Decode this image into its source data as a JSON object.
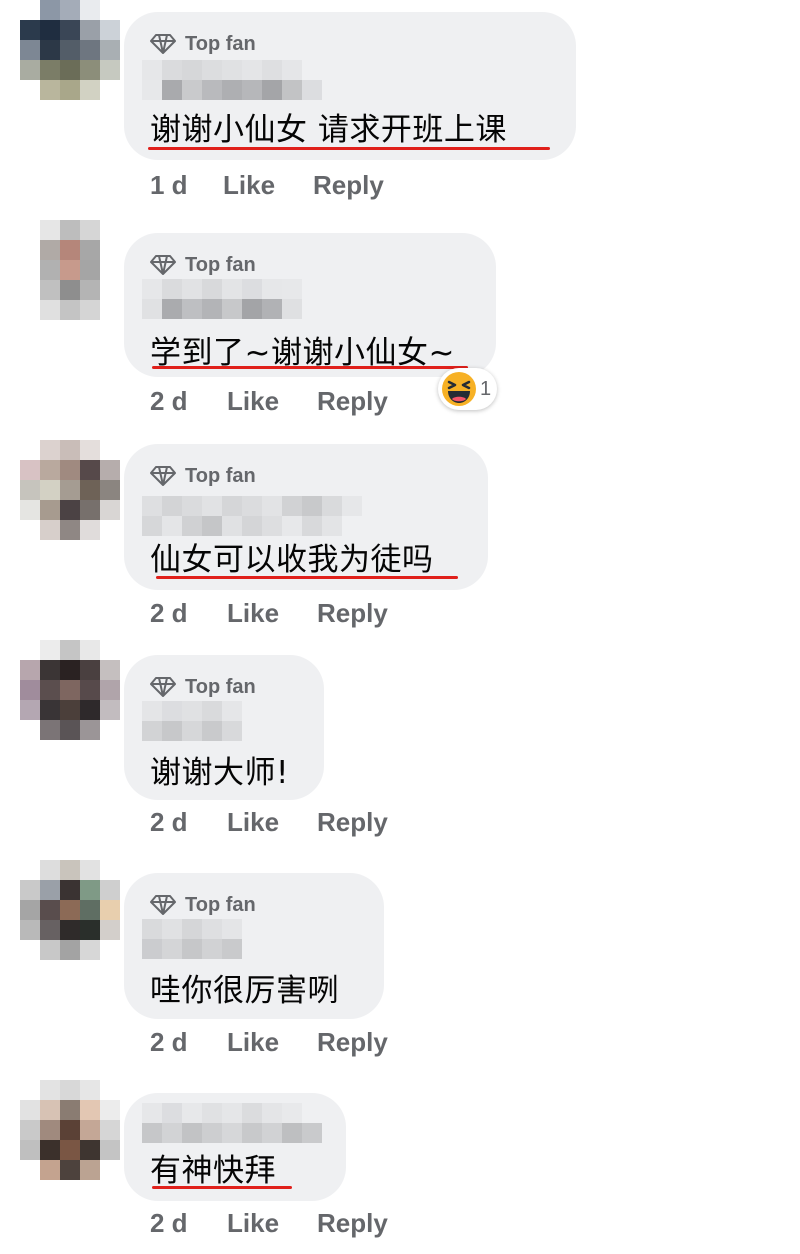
{
  "ui": {
    "top_fan_label": "Top fan",
    "like_label": "Like",
    "reply_label": "Reply",
    "icons": {
      "badge": "diamond-icon",
      "reaction": "laughing-face-icon"
    },
    "colors": {
      "bubble": "#eff0f2",
      "meta_text": "#65676b",
      "underline": "#e0201b"
    }
  },
  "comments": [
    {
      "text": "谢谢小仙女  请求开班上课",
      "time": "1 d",
      "top_fan": true
    },
    {
      "text": "学到了~谢谢小仙女~",
      "time": "2 d",
      "top_fan": true,
      "reaction_count": "1"
    },
    {
      "text": "仙女可以收我为徒吗",
      "time": "2 d",
      "top_fan": true
    },
    {
      "text": "谢谢大师!",
      "time": "2 d",
      "top_fan": true
    },
    {
      "text": "哇你很厉害咧",
      "time": "2 d",
      "top_fan": true
    },
    {
      "text": "有神快拜",
      "time": "2 d",
      "top_fan": false
    }
  ]
}
